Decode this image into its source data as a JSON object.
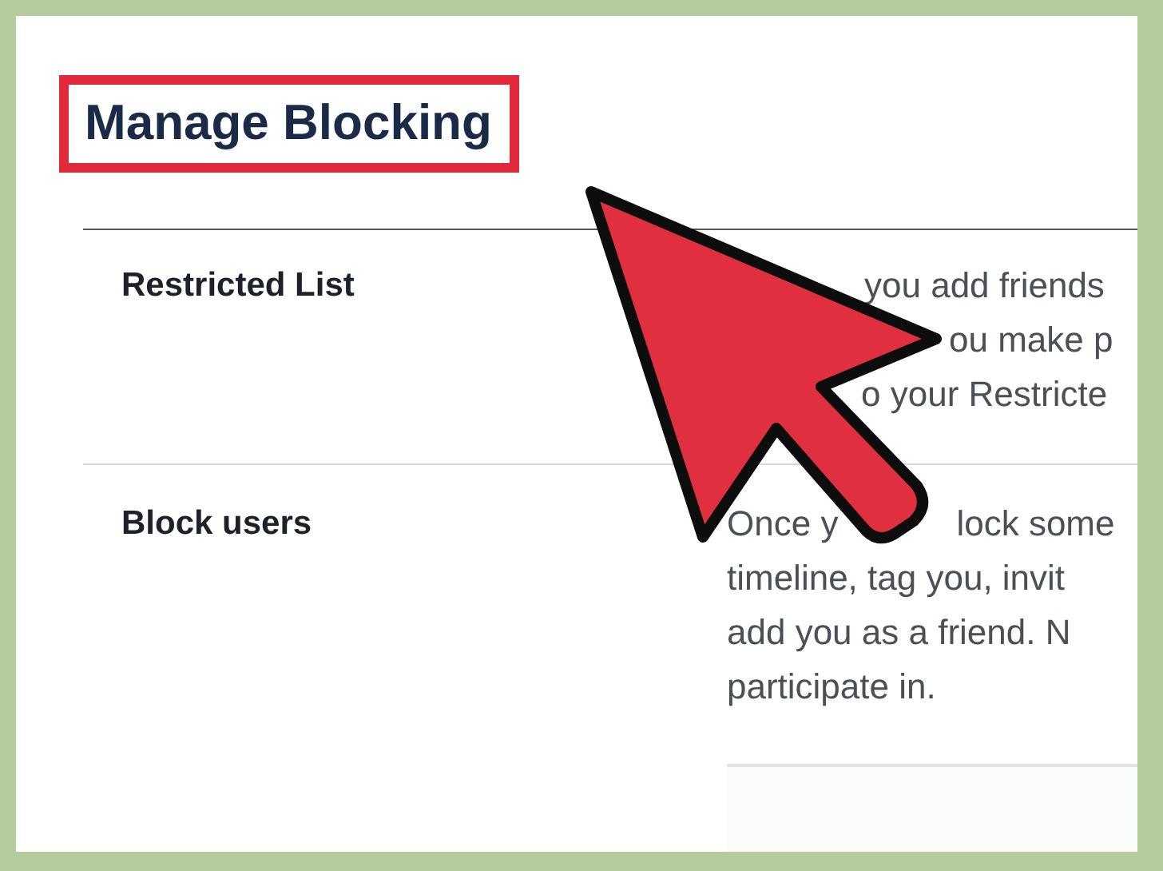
{
  "title": "Manage Blocking",
  "rows": [
    {
      "label": "Restricted List",
      "lines": [
        [
          "you add friends"
        ],
        [
          "ou make p"
        ],
        [
          "o your Restricte"
        ]
      ]
    },
    {
      "label": "Block users",
      "lines": [
        [
          "Once y",
          "lock some"
        ],
        [
          "timeline, tag you, invit"
        ],
        [
          "add you as a friend. N"
        ],
        [
          "participate in."
        ]
      ]
    }
  ]
}
